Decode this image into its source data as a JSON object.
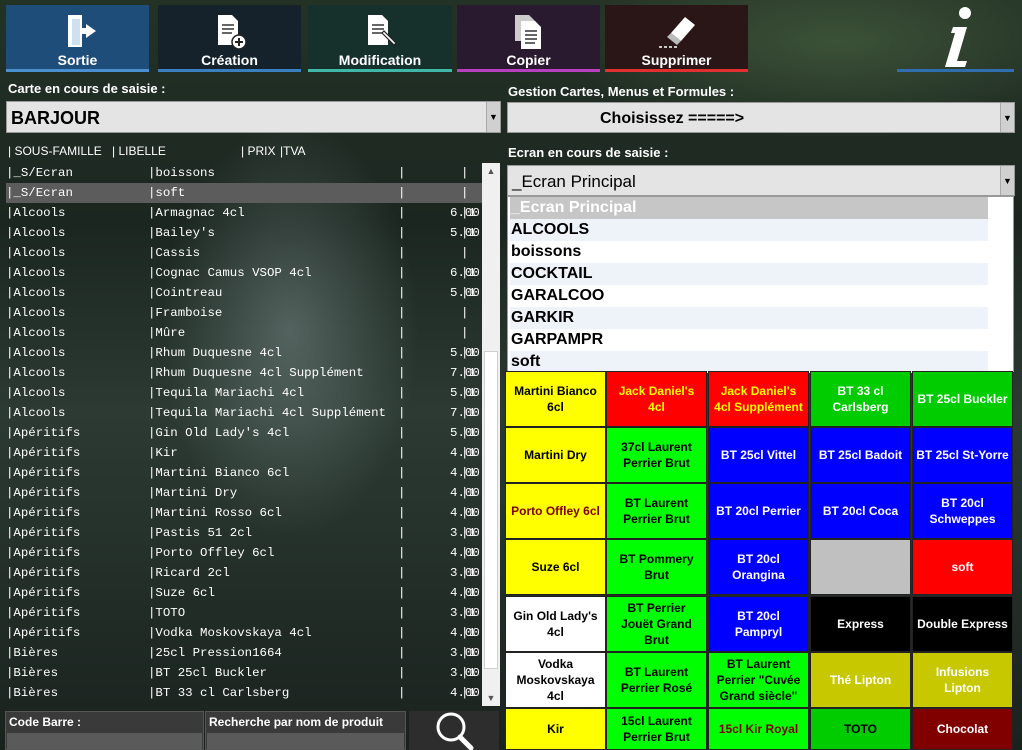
{
  "toolbar": [
    {
      "label": "Sortie",
      "icon": "exit-door-icon",
      "bg": "#1f4d7a",
      "bar": "#4a8fd0"
    },
    {
      "label": "Création",
      "icon": "create-document-icon",
      "bg": "#15222c",
      "bar": "#3a7fc0"
    },
    {
      "label": "Modification",
      "icon": "edit-document-icon",
      "bg": "#16302c",
      "bar": "#3fb8a8"
    },
    {
      "label": "Copier",
      "icon": "copy-icon",
      "bg": "#2a1a30",
      "bar": "#b840c0"
    },
    {
      "label": "Supprimer",
      "icon": "eraser-icon",
      "bg": "#2a1616",
      "bar": "#e03030"
    },
    {
      "label": "",
      "icon": "info-icon",
      "bg": "rgba(0,0,0,0)",
      "bar": "#2f6fb0"
    }
  ],
  "carte": {
    "label": "Carte en cours de saisie :",
    "value": "BARJOUR"
  },
  "gestion": {
    "label": "Gestion Cartes, Menus et Formules  :",
    "value": "Choisissez  =====>"
  },
  "ecran": {
    "label": "Ecran en cours de saisie :",
    "value": "_Ecran Principal"
  },
  "columns": {
    "sousfamille": "| SOUS-FAMILLE",
    "libelle": "| LIBELLE",
    "prix": "| PRIX",
    "tva": "|TVA"
  },
  "rows": [
    [
      "|_S/Ecran",
      "|boissons",
      "|",
      "|"
    ],
    [
      "|_S/Ecran",
      "|soft",
      "|",
      "|"
    ],
    [
      "|Alcools",
      "|Armagnac 4cl",
      "|      6.00",
      "|1"
    ],
    [
      "|Alcools",
      "|Bailey's",
      "|      5.00",
      "|1"
    ],
    [
      "|Alcools",
      "|Cassis",
      "|",
      "|"
    ],
    [
      "|Alcools",
      "|Cognac Camus VSOP 4cl",
      "|      6.00",
      "|1"
    ],
    [
      "|Alcools",
      "|Cointreau",
      "|      5.00",
      "|1"
    ],
    [
      "|Alcools",
      "|Framboise",
      "|",
      "|"
    ],
    [
      "|Alcools",
      "|Mûre",
      "|",
      "|"
    ],
    [
      "|Alcools",
      "|Rhum Duquesne 4cl",
      "|      5.00",
      "|1"
    ],
    [
      "|Alcools",
      "|Rhum Duquesne 4cl Supplément",
      "|      7.00",
      "|1"
    ],
    [
      "|Alcools",
      "|Tequila Mariachi 4cl",
      "|      5.00",
      "|1"
    ],
    [
      "|Alcools",
      "|Tequila Mariachi 4cl Supplément",
      "|      7.00",
      "|1"
    ],
    [
      "|Apéritifs",
      "|Gin Old Lady's 4cl",
      "|      5.00",
      "|1"
    ],
    [
      "|Apéritifs",
      "|Kir",
      "|      4.00",
      "|1"
    ],
    [
      "|Apéritifs",
      "|Martini Bianco 6cl",
      "|      4.00",
      "|1"
    ],
    [
      "|Apéritifs",
      "|Martini Dry",
      "|      4.00",
      "|1"
    ],
    [
      "|Apéritifs",
      "|Martini Rosso 6cl",
      "|      4.00",
      "|1"
    ],
    [
      "|Apéritifs",
      "|Pastis 51 2cl",
      "|      3.00",
      "|1"
    ],
    [
      "|Apéritifs",
      "|Porto Offley 6cl",
      "|      4.00",
      "|1"
    ],
    [
      "|Apéritifs",
      "|Ricard 2cl",
      "|      3.00",
      "|1"
    ],
    [
      "|Apéritifs",
      "|Suze 6cl",
      "|      4.00",
      "|1"
    ],
    [
      "|Apéritifs",
      "|TOTO",
      "|      3.00",
      "|1"
    ],
    [
      "|Apéritifs",
      "|Vodka Moskovskaya 4cl",
      "|      4.00",
      "|1"
    ],
    [
      "|Bières",
      "|25cl Pression1664",
      "|      3.00",
      "|1"
    ],
    [
      "|Bières",
      "|BT 25cl Buckler",
      "|      3.00",
      "|1"
    ],
    [
      "|Bières",
      "|BT 33 cl Carlsberg",
      "|      4.00",
      "|1"
    ]
  ],
  "selected_row": 1,
  "bottom": {
    "code_barre": "Code Barre :",
    "recherche": "Recherche par nom de produit",
    "search_icon": "search-icon"
  },
  "dropdown": [
    "_Ecran Principal",
    "ALCOOLS",
    "boissons",
    "COCKTAIL",
    "GARALCOO",
    "GARKIR",
    "GARPAMPR",
    "soft"
  ],
  "grid": [
    [
      {
        "t": "Martini Bianco 6cl",
        "bg": "#ffff00",
        "fg": "#000000"
      },
      {
        "t": "Jack Daniel's 4cl",
        "bg": "#ff0000",
        "fg": "#ffff00"
      },
      {
        "t": "Jack Daniel's 4cl Supplément",
        "bg": "#ff0000",
        "fg": "#ffff00"
      },
      {
        "t": "BT 33 cl Carlsberg",
        "bg": "#00cc00",
        "fg": "#ffffff"
      },
      {
        "t": "BT 25cl Buckler",
        "bg": "#00cc00",
        "fg": "#ffffff"
      }
    ],
    [
      {
        "t": "Martini Dry",
        "bg": "#ffff00",
        "fg": "#000000"
      },
      {
        "t": "37cl Laurent Perrier Brut",
        "bg": "#00ff00",
        "fg": "#000000"
      },
      {
        "t": "BT 25cl Vittel",
        "bg": "#0000ff",
        "fg": "#ffffff"
      },
      {
        "t": "BT 25cl Badoit",
        "bg": "#0000ff",
        "fg": "#ffffff"
      },
      {
        "t": "BT 25cl St-Yorre",
        "bg": "#0000ff",
        "fg": "#ffffff"
      }
    ],
    [
      {
        "t": "Porto Offley 6cl",
        "bg": "#ffff00",
        "fg": "#800000"
      },
      {
        "t": "BT Laurent Perrier Brut",
        "bg": "#00ff00",
        "fg": "#000000"
      },
      {
        "t": "BT 20cl Perrier",
        "bg": "#0000ff",
        "fg": "#ffffff"
      },
      {
        "t": "BT 20cl Coca",
        "bg": "#0000ff",
        "fg": "#ffffff"
      },
      {
        "t": "BT 20cl Schweppes",
        "bg": "#0000ff",
        "fg": "#ffffff"
      }
    ],
    [
      {
        "t": "Suze 6cl",
        "bg": "#ffff00",
        "fg": "#000000"
      },
      {
        "t": "BT Pommery Brut",
        "bg": "#00ff00",
        "fg": "#000000"
      },
      {
        "t": "BT 20cl Orangina",
        "bg": "#0000ff",
        "fg": "#ffffff"
      },
      {
        "t": "",
        "bg": "#c0c0c0",
        "fg": "#000000"
      },
      {
        "t": "soft",
        "bg": "#ff0000",
        "fg": "#ffffff"
      }
    ],
    [
      {
        "t": "Gin Old Lady's 4cl",
        "bg": "#ffffff",
        "fg": "#000000"
      },
      {
        "t": "BT Perrier Jouët Grand Brut",
        "bg": "#00ff00",
        "fg": "#000000"
      },
      {
        "t": "BT 20cl Pampryl",
        "bg": "#0000ff",
        "fg": "#ffffff"
      },
      {
        "t": "Express",
        "bg": "#000000",
        "fg": "#ffffff"
      },
      {
        "t": "Double Express",
        "bg": "#000000",
        "fg": "#ffffff"
      }
    ],
    [
      {
        "t": "Vodka Moskovskaya 4cl",
        "bg": "#ffffff",
        "fg": "#000000"
      },
      {
        "t": "BT Laurent Perrier Rosé",
        "bg": "#00ff00",
        "fg": "#000000"
      },
      {
        "t": "BT Laurent Perrier \"Cuvée Grand siècle\"",
        "bg": "#00ff00",
        "fg": "#000000"
      },
      {
        "t": "Thé Lipton",
        "bg": "#c8c800",
        "fg": "#ffffff"
      },
      {
        "t": "Infusions Lipton",
        "bg": "#c8c800",
        "fg": "#ffffff"
      }
    ],
    [
      {
        "t": "Kir",
        "bg": "#ffff00",
        "fg": "#000000"
      },
      {
        "t": "15cl Laurent Perrier Brut",
        "bg": "#00ff00",
        "fg": "#000000"
      },
      {
        "t": "15cl Kir Royal",
        "bg": "#00ff00",
        "fg": "#800000"
      },
      {
        "t": "TOTO",
        "bg": "#00cc00",
        "fg": "#000000"
      },
      {
        "t": "Chocolat",
        "bg": "#800000",
        "fg": "#ffffff"
      }
    ]
  ]
}
